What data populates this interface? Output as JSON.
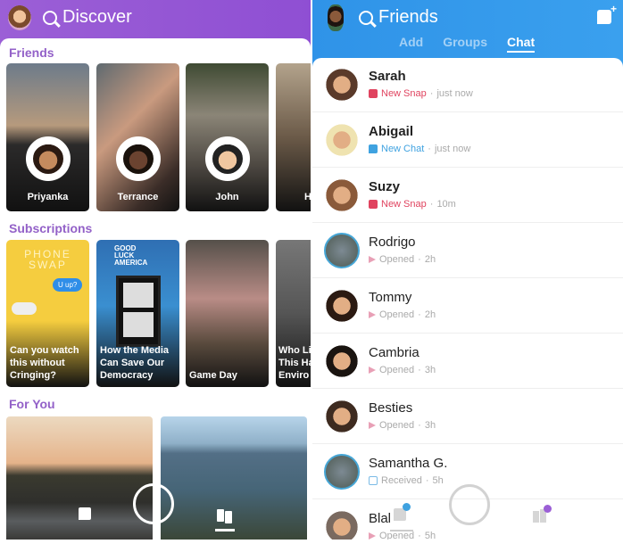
{
  "discover": {
    "title": "Discover",
    "sections": {
      "friends": "Friends",
      "subscriptions": "Subscriptions",
      "for_you": "For You"
    },
    "friends": [
      {
        "name": "Priyanka"
      },
      {
        "name": "Terrance"
      },
      {
        "name": "John"
      },
      {
        "name": "H"
      }
    ],
    "subscriptions": [
      {
        "caption": "Can you watch\nthis without\nCringing?",
        "art": "PHONE\nSWAP",
        "bubble": "U up?"
      },
      {
        "caption": "How the Media\nCan Save Our\nDemocracy",
        "art": "GOOD\nLUCK\nAMERICA"
      },
      {
        "caption": "Game Day"
      },
      {
        "caption": "Who Li\nThis Ha\nEnviro"
      }
    ]
  },
  "friends_screen": {
    "title": "Friends",
    "tabs": [
      "Add",
      "Groups",
      "Chat"
    ],
    "active_tab": "Chat",
    "chats": [
      {
        "name": "Sarah",
        "status": "New Snap",
        "time": "just now",
        "type": "new-snap",
        "unread": true
      },
      {
        "name": "Abigail",
        "status": "New Chat",
        "time": "just now",
        "type": "new-chat",
        "unread": true
      },
      {
        "name": "Suzy",
        "status": "New Snap",
        "time": "10m",
        "type": "new-snap",
        "unread": true
      },
      {
        "name": "Rodrigo",
        "status": "Opened",
        "time": "2h",
        "type": "opened",
        "unread": false
      },
      {
        "name": "Tommy",
        "status": "Opened",
        "time": "2h",
        "type": "opened",
        "unread": false
      },
      {
        "name": "Cambria",
        "status": "Opened",
        "time": "3h",
        "type": "opened",
        "unread": false
      },
      {
        "name": "Besties",
        "status": "Opened",
        "time": "3h",
        "type": "opened",
        "unread": false
      },
      {
        "name": "Samantha G.",
        "status": "Received",
        "time": "5h",
        "type": "received",
        "unread": false
      },
      {
        "name": "Blal",
        "status": "Opened",
        "time": "5h",
        "type": "opened",
        "unread": false
      }
    ]
  },
  "colors": {
    "discover_accent": "#9361c8",
    "friends_accent": "#3aa0ee",
    "new_snap": "#e0435f",
    "new_chat": "#3fa2e0",
    "chat_badge": "#3fa2e0",
    "stories_badge": "#9b5fd6"
  }
}
